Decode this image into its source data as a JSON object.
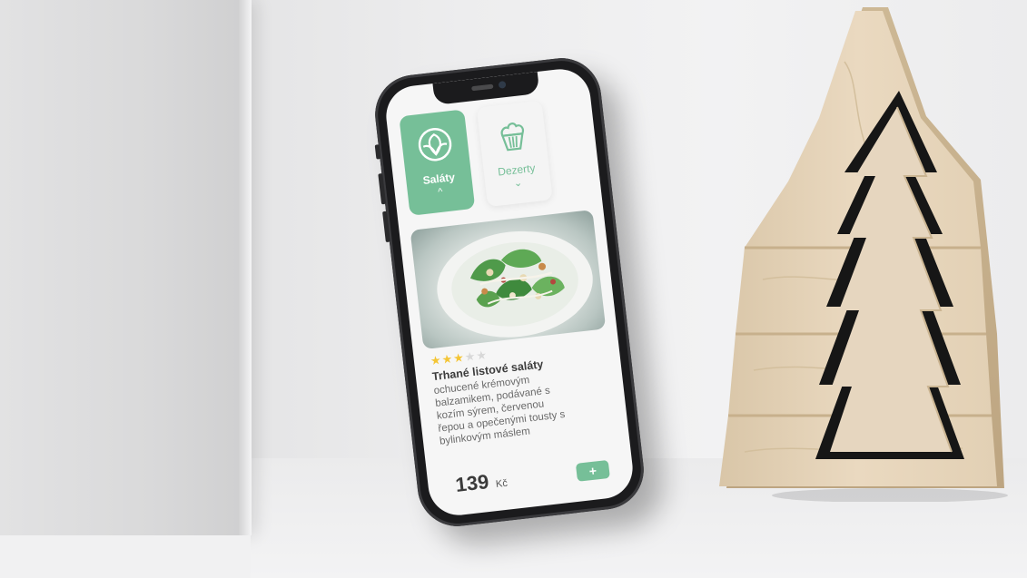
{
  "app": {
    "categories": [
      {
        "label": "Saláty",
        "icon": "salad-icon",
        "chevron": "^",
        "active": true
      },
      {
        "label": "Dezerty",
        "icon": "cupcake-icon",
        "chevron": "⌄",
        "active": false
      }
    ],
    "item": {
      "rating": 3,
      "rating_max": 5,
      "title": "Trhané listové saláty",
      "description": "ochucené krémovým balzamikem, podávané s kozím sýrem, červenou řepou a opečenými tousty s bylinkovým máslem",
      "price": "139",
      "currency": "Kč",
      "add_label": "+"
    }
  },
  "colors": {
    "accent": "#76bf98",
    "star": "#f4c534",
    "wood": "#e6d6bf"
  }
}
